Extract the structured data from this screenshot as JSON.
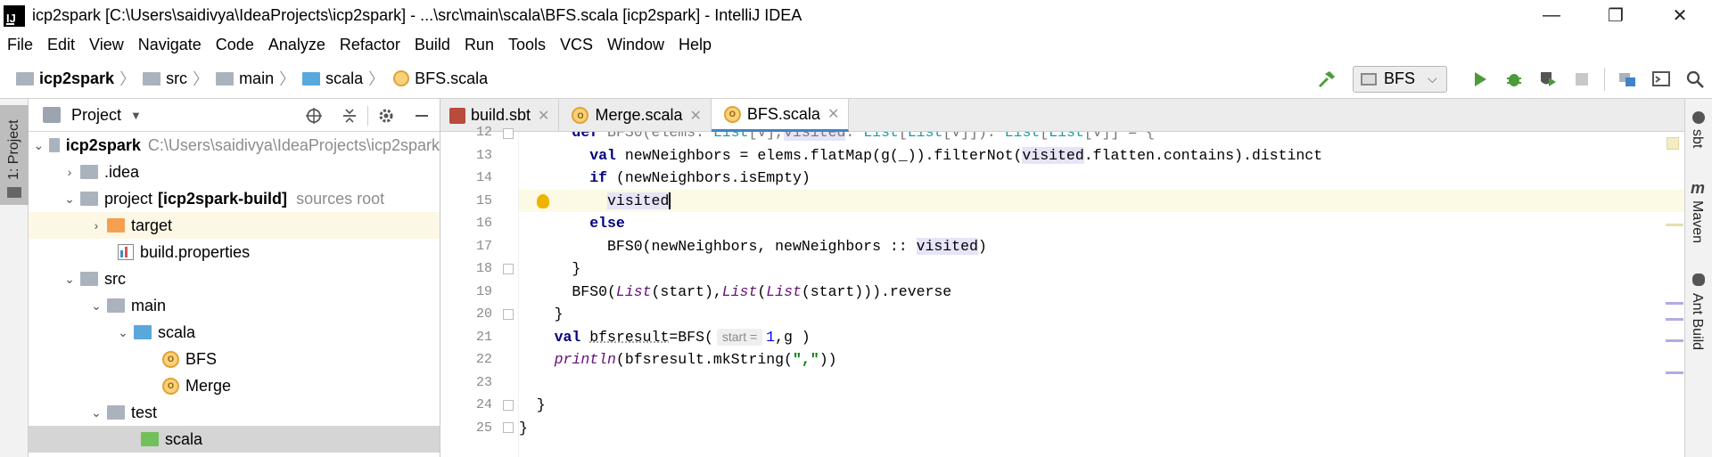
{
  "window": {
    "title": "icp2spark [C:\\Users\\saidivya\\IdeaProjects\\icp2spark] - ...\\src\\main\\scala\\BFS.scala [icp2spark] - IntelliJ IDEA",
    "logo_text": "IJ",
    "minimize": "—",
    "restore": "❐",
    "close": "✕"
  },
  "menu": [
    "File",
    "Edit",
    "View",
    "Navigate",
    "Code",
    "Analyze",
    "Refactor",
    "Build",
    "Run",
    "Tools",
    "VCS",
    "Window",
    "Help"
  ],
  "breadcrumbs": [
    "icp2spark",
    "src",
    "main",
    "scala",
    "BFS.scala"
  ],
  "toolbar": {
    "run_config": "BFS",
    "run_config_caret": "⌵"
  },
  "left_stripe": {
    "project_tab": "1: Project"
  },
  "project_panel": {
    "title": "Project",
    "tree": {
      "root_name": "icp2spark",
      "root_path": "C:\\Users\\saidivya\\IdeaProjects\\icp2spark",
      "idea": ".idea",
      "project_name": "project",
      "project_module": "[icp2spark-build]",
      "project_note": "sources root",
      "target": "target",
      "build_properties": "build.properties",
      "src": "src",
      "main": "main",
      "scala": "scala",
      "bfs": "BFS",
      "merge": "Merge",
      "test": "test",
      "test_scala": "scala"
    }
  },
  "tabs": [
    "build.sbt",
    "Merge.scala",
    "BFS.scala"
  ],
  "tab_close": "✕",
  "editor": {
    "line_numbers": [
      "12",
      "13",
      "14",
      "15",
      "16",
      "17",
      "18",
      "19",
      "20",
      "21",
      "22",
      "23",
      "24",
      "25"
    ],
    "hint_start": "start ="
  },
  "right_stripe": [
    "sbt",
    "Maven",
    "Ant Build"
  ],
  "colors": {
    "accent": "#4083c9",
    "keyword": "#000080",
    "string": "#008000",
    "current_line": "#fcf9e4",
    "selection": "#d5d5d5"
  }
}
